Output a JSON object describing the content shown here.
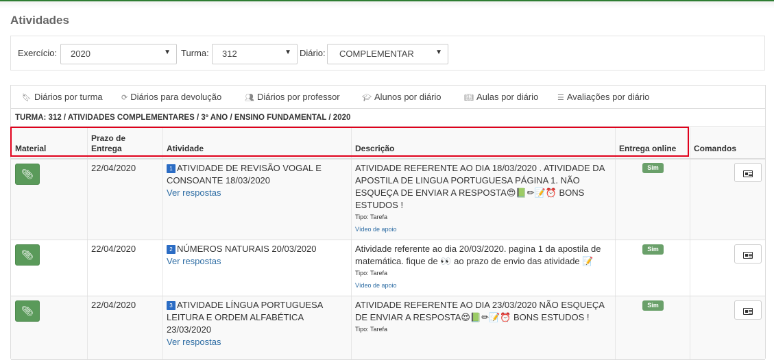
{
  "page": {
    "title": "Atividades"
  },
  "filters": {
    "exercicio": {
      "label": "Exercício:",
      "value": "2020"
    },
    "turma": {
      "label": "Turma:",
      "value": "312"
    },
    "diario": {
      "label": "Diário:",
      "value": "COMPLEMENTAR"
    }
  },
  "tabs": [
    {
      "label": "Diários por turma",
      "icon": "bookmark-icon"
    },
    {
      "label": "Diários para devolução",
      "icon": "refresh-icon"
    },
    {
      "label": "Diários por professor",
      "icon": "users-icon"
    },
    {
      "label": "Alunos por diário",
      "icon": "graduation-cap-icon"
    },
    {
      "label": "Aulas por diário",
      "icon": "book-icon"
    },
    {
      "label": "Avaliações por diário",
      "icon": "list-icon"
    }
  ],
  "caption": "TURMA: 312 / ATIVIDADES COMPLEMENTARES / 3º ANO / ENSINO FUNDAMENTAL / 2020",
  "headers": {
    "material": "Material",
    "prazo_line1": "Prazo de",
    "prazo_line2": "Entrega",
    "atividade": "Atividade",
    "descricao": "Descrição",
    "entrega": "Entrega online",
    "comandos": "Comandos"
  },
  "rows": [
    {
      "date": "22/04/2020",
      "num": "1",
      "activity_l1": "ATIVIDADE DE REVISÃO VOGAL E",
      "activity_l2": "CONSOANTE 18/03/2020",
      "link": "Ver respostas",
      "desc_l1": "ATIVIDADE REFERENTE AO DIA 18/03/2020 . ATIVIDADE DA",
      "desc_l2": "APOSTILA DE LINGUA PORTUGUESA PÁGINA 1. NÃO",
      "desc_l3": "ESQUEÇA DE ENVIAR A RESPOSTA😍📗✏📝⏰ BONS",
      "desc_l4": "ESTUDOS !",
      "tipo": "Tipo: Tarefa",
      "video": "Vídeo de apoio",
      "online": "Sim"
    },
    {
      "date": "22/04/2020",
      "num": "2",
      "activity_l1": "NÚMEROS NATURAIS 20/03/2020",
      "link": "Ver respostas",
      "desc_l1": "Atividade referente ao dia 20/03/2020. pagina 1 da apostila de",
      "desc_l2": "matemática. fique de 👀 ao prazo de envio das atividade 📝",
      "tipo": "Tipo: Tarefa",
      "video": "Vídeo de apoio",
      "online": "Sim"
    },
    {
      "date": "22/04/2020",
      "num": "3",
      "activity_l1": "ATIVIDADE LÍNGUA PORTUGUESA",
      "activity_l2": "LEITURA E ORDEM ALFABÉTICA",
      "activity_l3": "23/03/2020",
      "link": "Ver respostas",
      "desc_l1": "ATIVIDADE REFERENTE AO DIA 23/03/2020 NÃO ESQUEÇA",
      "desc_l2": "DE ENVIAR A RESPOSTA😍📗✏📝⏰ BONS ESTUDOS !",
      "tipo": "Tipo: Tarefa",
      "online": "Sim"
    }
  ],
  "colors": {
    "accent_green": "#5a9a5a",
    "link_blue": "#2e6da4",
    "highlight_red": "#e0001b"
  }
}
